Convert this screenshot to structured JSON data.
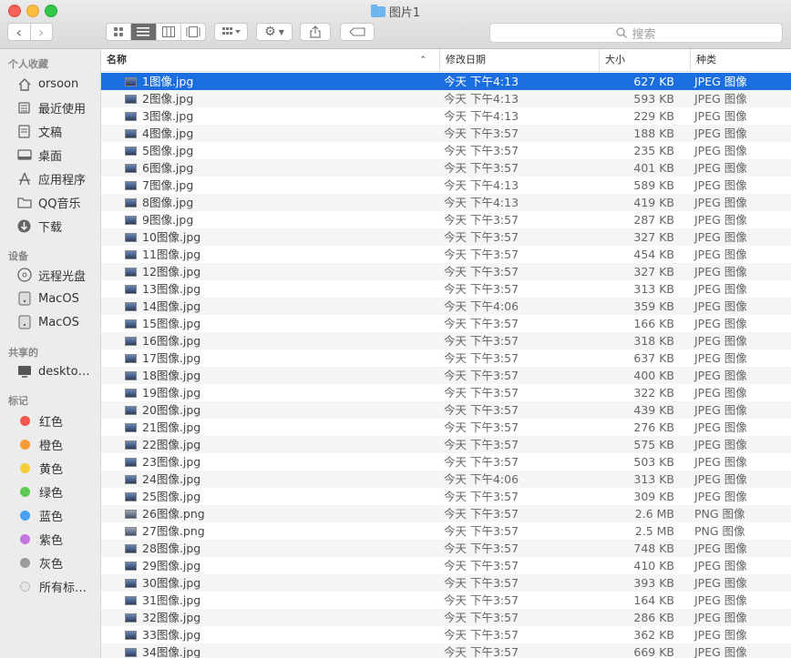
{
  "window": {
    "title": "图片1"
  },
  "toolbar": {
    "back": "‹",
    "forward": "›",
    "search_placeholder": "搜索"
  },
  "sidebar": {
    "sections": [
      {
        "title": "个人收藏",
        "items": [
          {
            "label": "orsoon",
            "icon": "home-icon"
          },
          {
            "label": "最近使用",
            "icon": "recents-icon"
          },
          {
            "label": "文稿",
            "icon": "document-icon"
          },
          {
            "label": "桌面",
            "icon": "desktop-icon"
          },
          {
            "label": "应用程序",
            "icon": "applications-icon"
          },
          {
            "label": "QQ音乐",
            "icon": "folder-icon"
          },
          {
            "label": "下载",
            "icon": "download-icon"
          }
        ]
      },
      {
        "title": "设备",
        "items": [
          {
            "label": "远程光盘",
            "icon": "disc-icon"
          },
          {
            "label": "MacOS",
            "icon": "drive-icon"
          },
          {
            "label": "MacOS",
            "icon": "drive-icon"
          }
        ]
      },
      {
        "title": "共享的",
        "items": [
          {
            "label": "deskto…",
            "icon": "computer-icon"
          }
        ]
      },
      {
        "title": "标记",
        "tags": [
          {
            "label": "红色",
            "color": "#f0564f"
          },
          {
            "label": "橙色",
            "color": "#f49c38"
          },
          {
            "label": "黄色",
            "color": "#f3cd3e"
          },
          {
            "label": "绿色",
            "color": "#5fc852"
          },
          {
            "label": "蓝色",
            "color": "#4aa0f0"
          },
          {
            "label": "紫色",
            "color": "#c377dc"
          },
          {
            "label": "灰色",
            "color": "#9b9b9b"
          },
          {
            "label": "所有标…",
            "color": "#dddddd"
          }
        ]
      }
    ]
  },
  "columns": {
    "name": "名称",
    "date": "修改日期",
    "size": "大小",
    "kind": "种类"
  },
  "files": [
    {
      "name": "1图像.jpg",
      "date": "今天 下午4:13",
      "size": "627 KB",
      "kind": "JPEG 图像",
      "selected": true
    },
    {
      "name": "2图像.jpg",
      "date": "今天 下午4:13",
      "size": "593 KB",
      "kind": "JPEG 图像"
    },
    {
      "name": "3图像.jpg",
      "date": "今天 下午4:13",
      "size": "229 KB",
      "kind": "JPEG 图像"
    },
    {
      "name": "4图像.jpg",
      "date": "今天 下午3:57",
      "size": "188 KB",
      "kind": "JPEG 图像"
    },
    {
      "name": "5图像.jpg",
      "date": "今天 下午3:57",
      "size": "235 KB",
      "kind": "JPEG 图像"
    },
    {
      "name": "6图像.jpg",
      "date": "今天 下午3:57",
      "size": "401 KB",
      "kind": "JPEG 图像"
    },
    {
      "name": "7图像.jpg",
      "date": "今天 下午4:13",
      "size": "589 KB",
      "kind": "JPEG 图像"
    },
    {
      "name": "8图像.jpg",
      "date": "今天 下午4:13",
      "size": "419 KB",
      "kind": "JPEG 图像"
    },
    {
      "name": "9图像.jpg",
      "date": "今天 下午3:57",
      "size": "287 KB",
      "kind": "JPEG 图像"
    },
    {
      "name": "10图像.jpg",
      "date": "今天 下午3:57",
      "size": "327 KB",
      "kind": "JPEG 图像"
    },
    {
      "name": "11图像.jpg",
      "date": "今天 下午3:57",
      "size": "454 KB",
      "kind": "JPEG 图像"
    },
    {
      "name": "12图像.jpg",
      "date": "今天 下午3:57",
      "size": "327 KB",
      "kind": "JPEG 图像"
    },
    {
      "name": "13图像.jpg",
      "date": "今天 下午3:57",
      "size": "313 KB",
      "kind": "JPEG 图像"
    },
    {
      "name": "14图像.jpg",
      "date": "今天 下午4:06",
      "size": "359 KB",
      "kind": "JPEG 图像"
    },
    {
      "name": "15图像.jpg",
      "date": "今天 下午3:57",
      "size": "166 KB",
      "kind": "JPEG 图像"
    },
    {
      "name": "16图像.jpg",
      "date": "今天 下午3:57",
      "size": "318 KB",
      "kind": "JPEG 图像"
    },
    {
      "name": "17图像.jpg",
      "date": "今天 下午3:57",
      "size": "637 KB",
      "kind": "JPEG 图像"
    },
    {
      "name": "18图像.jpg",
      "date": "今天 下午3:57",
      "size": "400 KB",
      "kind": "JPEG 图像"
    },
    {
      "name": "19图像.jpg",
      "date": "今天 下午3:57",
      "size": "322 KB",
      "kind": "JPEG 图像"
    },
    {
      "name": "20图像.jpg",
      "date": "今天 下午3:57",
      "size": "439 KB",
      "kind": "JPEG 图像"
    },
    {
      "name": "21图像.jpg",
      "date": "今天 下午3:57",
      "size": "276 KB",
      "kind": "JPEG 图像"
    },
    {
      "name": "22图像.jpg",
      "date": "今天 下午3:57",
      "size": "575 KB",
      "kind": "JPEG 图像"
    },
    {
      "name": "23图像.jpg",
      "date": "今天 下午3:57",
      "size": "503 KB",
      "kind": "JPEG 图像"
    },
    {
      "name": "24图像.jpg",
      "date": "今天 下午4:06",
      "size": "313 KB",
      "kind": "JPEG 图像"
    },
    {
      "name": "25图像.jpg",
      "date": "今天 下午3:57",
      "size": "309 KB",
      "kind": "JPEG 图像"
    },
    {
      "name": "26图像.png",
      "date": "今天 下午3:57",
      "size": "2.6 MB",
      "kind": "PNG 图像"
    },
    {
      "name": "27图像.png",
      "date": "今天 下午3:57",
      "size": "2.5 MB",
      "kind": "PNG 图像"
    },
    {
      "name": "28图像.jpg",
      "date": "今天 下午3:57",
      "size": "748 KB",
      "kind": "JPEG 图像"
    },
    {
      "name": "29图像.jpg",
      "date": "今天 下午3:57",
      "size": "410 KB",
      "kind": "JPEG 图像"
    },
    {
      "name": "30图像.jpg",
      "date": "今天 下午3:57",
      "size": "393 KB",
      "kind": "JPEG 图像"
    },
    {
      "name": "31图像.jpg",
      "date": "今天 下午3:57",
      "size": "164 KB",
      "kind": "JPEG 图像"
    },
    {
      "name": "32图像.jpg",
      "date": "今天 下午3:57",
      "size": "286 KB",
      "kind": "JPEG 图像"
    },
    {
      "name": "33图像.jpg",
      "date": "今天 下午3:57",
      "size": "362 KB",
      "kind": "JPEG 图像"
    },
    {
      "name": "34图像.jpg",
      "date": "今天 下午3:57",
      "size": "669 KB",
      "kind": "JPEG 图像"
    }
  ]
}
